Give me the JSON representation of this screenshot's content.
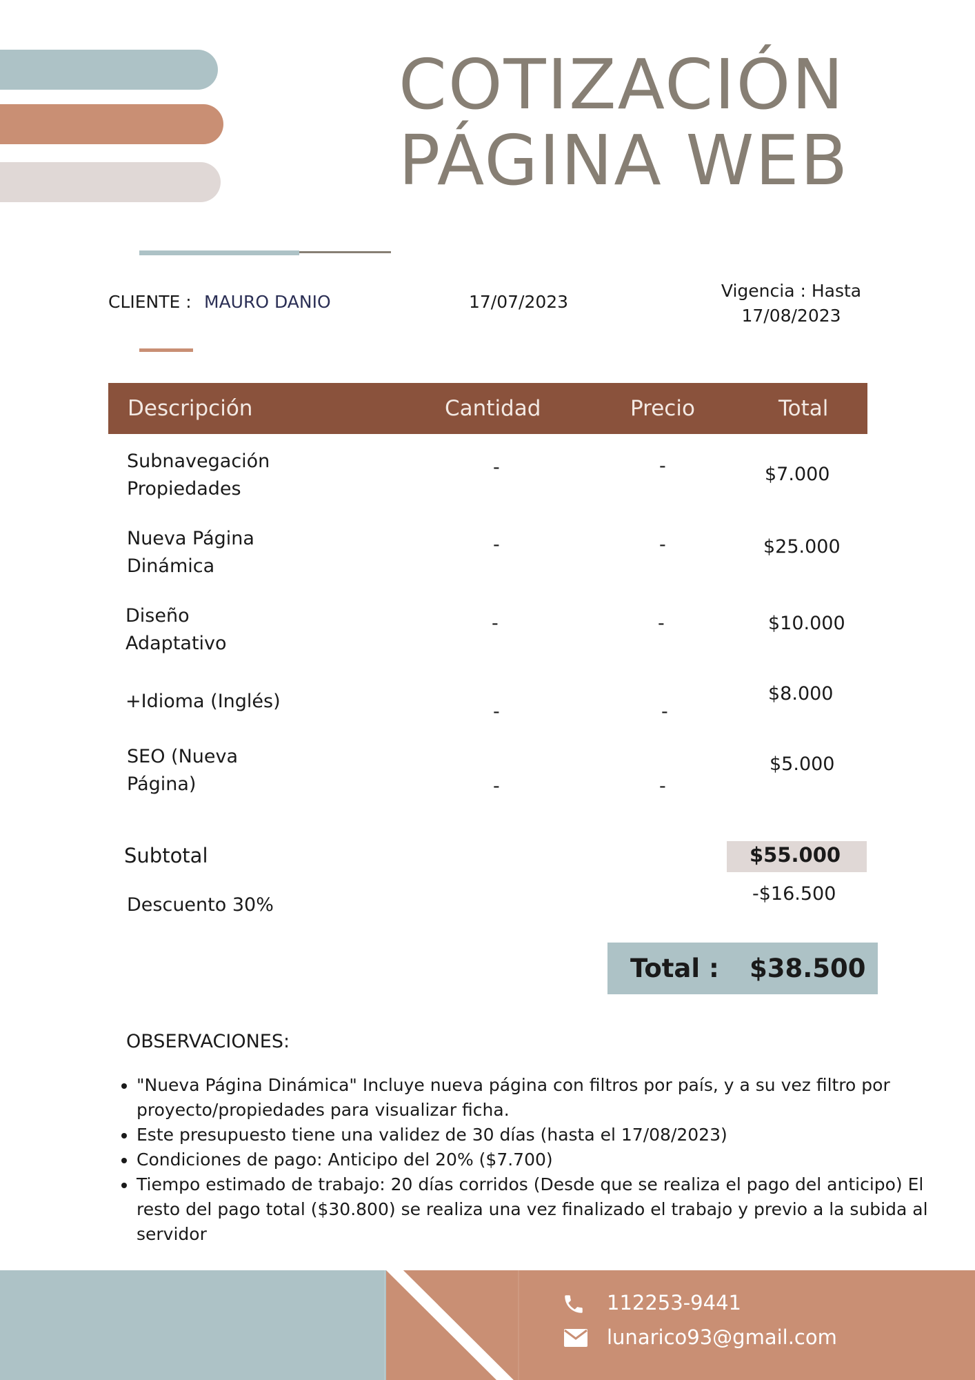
{
  "title": {
    "line1": "COTIZACIÓN",
    "line2": "PÁGINA WEB"
  },
  "client": {
    "label": "CLIENTE :",
    "name": "MAURO DANIO"
  },
  "date": "17/07/2023",
  "validity": {
    "line1": "Vigencia : Hasta",
    "line2": "17/08/2023"
  },
  "table": {
    "headers": [
      "Descripción",
      "Cantidad",
      "Precio",
      "Total"
    ],
    "rows": [
      {
        "desc1": "Subnavegación",
        "desc2": "Propiedades",
        "qty": "-",
        "price": "-",
        "total": "$7.000"
      },
      {
        "desc1": "Nueva Página",
        "desc2": "Dinámica",
        "qty": "-",
        "price": "-",
        "total": "$25.000"
      },
      {
        "desc1": "Diseño",
        "desc2": "Adaptativo",
        "qty": "-",
        "price": "-",
        "total": "$10.000"
      },
      {
        "desc1": "+Idioma (Inglés)",
        "desc2": "",
        "qty": "-",
        "price": "-",
        "total": "$8.000"
      },
      {
        "desc1": "SEO (Nueva",
        "desc2": "Página)",
        "qty": "-",
        "price": "-",
        "total": "$5.000"
      }
    ]
  },
  "summary": {
    "subtotal_label": "Subtotal",
    "subtotal_value": "$55.000",
    "discount_label": "Descuento 30%",
    "discount_value": "-$16.500",
    "total_label": "Total :",
    "total_value": "$38.500"
  },
  "observations": {
    "title": "OBSERVACIONES:",
    "items": [
      "\"Nueva Página Dinámica\" Incluye nueva página con filtros por país, y a su vez filtro por proyecto/propiedades para visualizar ficha.",
      "Este presupuesto tiene una validez de 30 días (hasta el 17/08/2023)",
      "Condiciones de pago: Anticipo del 20% ($7.700)",
      "Tiempo estimado de trabajo: 20 días corridos (Desde que se realiza el pago del anticipo) El resto del pago total ($30.800) se realiza una vez finalizado el trabajo y previo a la subida al servidor"
    ]
  },
  "contact": {
    "phone": "112253-9441",
    "email": "lunarico93@gmail.com",
    "phone_icon": "phone-icon",
    "email_icon": "envelope-icon"
  },
  "colors": {
    "blue": "#adc2c6",
    "terracotta": "#c98f74",
    "brown": "#8a523c",
    "gray": "#e0d8d6",
    "title": "#877f74"
  }
}
